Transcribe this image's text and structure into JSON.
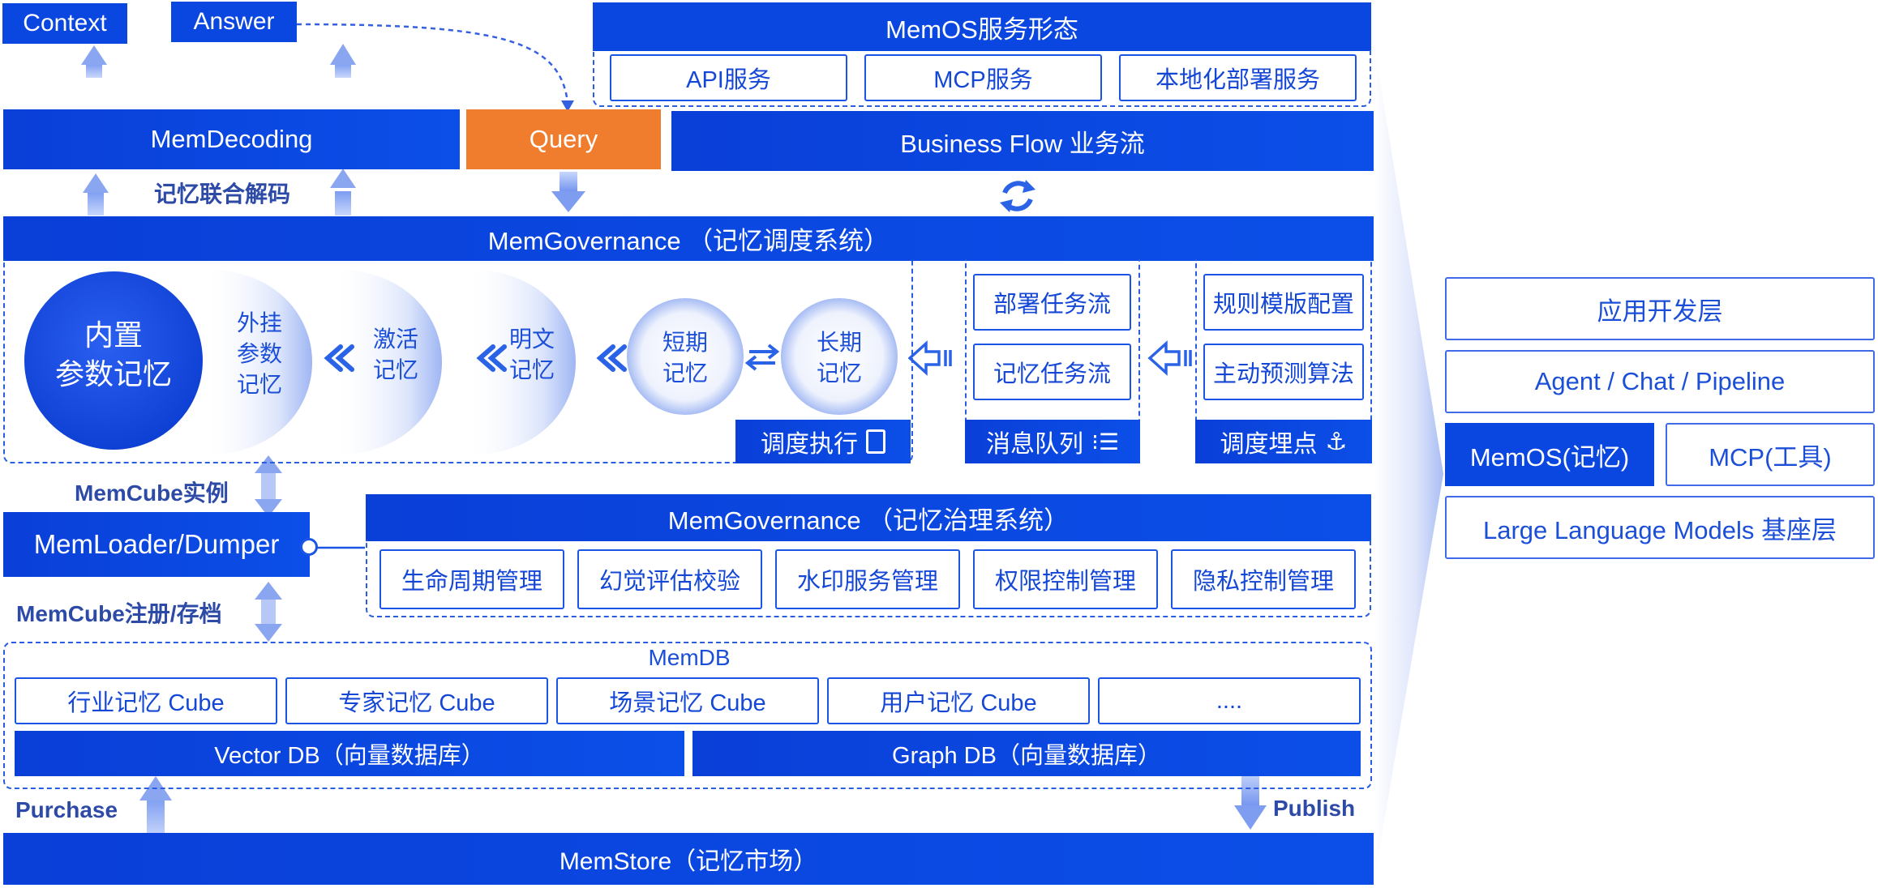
{
  "top": {
    "context": "Context",
    "answer": "Answer",
    "memdecoding": "MemDecoding",
    "query": "Query",
    "joint_decoding": "记忆联合解码"
  },
  "service": {
    "title": "MemOS服务形态",
    "items": [
      "API服务",
      "MCP服务",
      "本地化部署服务"
    ],
    "business_flow": "Business Flow 业务流"
  },
  "scheduler": {
    "title": "MemGovernance （记忆调度系统）",
    "builtin": "内置\n参数记忆",
    "plugin": "外挂\n参数\n记忆",
    "activation": "激活\n记忆",
    "plaintext": "明文\n记忆",
    "short_term": "短期\n记忆",
    "long_term": "长期\n记忆",
    "execute": "调度执行",
    "tasks": [
      "部署任务流",
      "记忆任务流"
    ],
    "queue": "消息队列",
    "rules": [
      "规则模版配置",
      "主动预测算法"
    ],
    "hooks": "调度埋点"
  },
  "memcube_instance": "MemCube实例",
  "memloader": "MemLoader/Dumper",
  "memcube_register": "MemCube注册/存档",
  "governance": {
    "title": "MemGovernance （记忆治理系统）",
    "items": [
      "生命周期管理",
      "幻觉评估校验",
      "水印服务管理",
      "权限控制管理",
      "隐私控制管理"
    ]
  },
  "memdb": {
    "title": "MemDB",
    "cubes": [
      "行业记忆 Cube",
      "专家记忆 Cube",
      "场景记忆 Cube",
      "用户记忆 Cube",
      "...."
    ],
    "vector": "Vector DB（向量数据库）",
    "graph": "Graph DB（向量数据库）"
  },
  "purchase": "Purchase",
  "publish": "Publish",
  "memstore": "MemStore（记忆市场）",
  "stack": {
    "app": "应用开发层",
    "agent": "Agent / Chat / Pipeline",
    "memos": "MemOS(记忆)",
    "mcp": "MCP(工具)",
    "llm": "Large Language Models 基座层"
  },
  "colors": {
    "primary": "#0a46e0",
    "query": "#ef7d2d",
    "border": "#1a55e6"
  }
}
